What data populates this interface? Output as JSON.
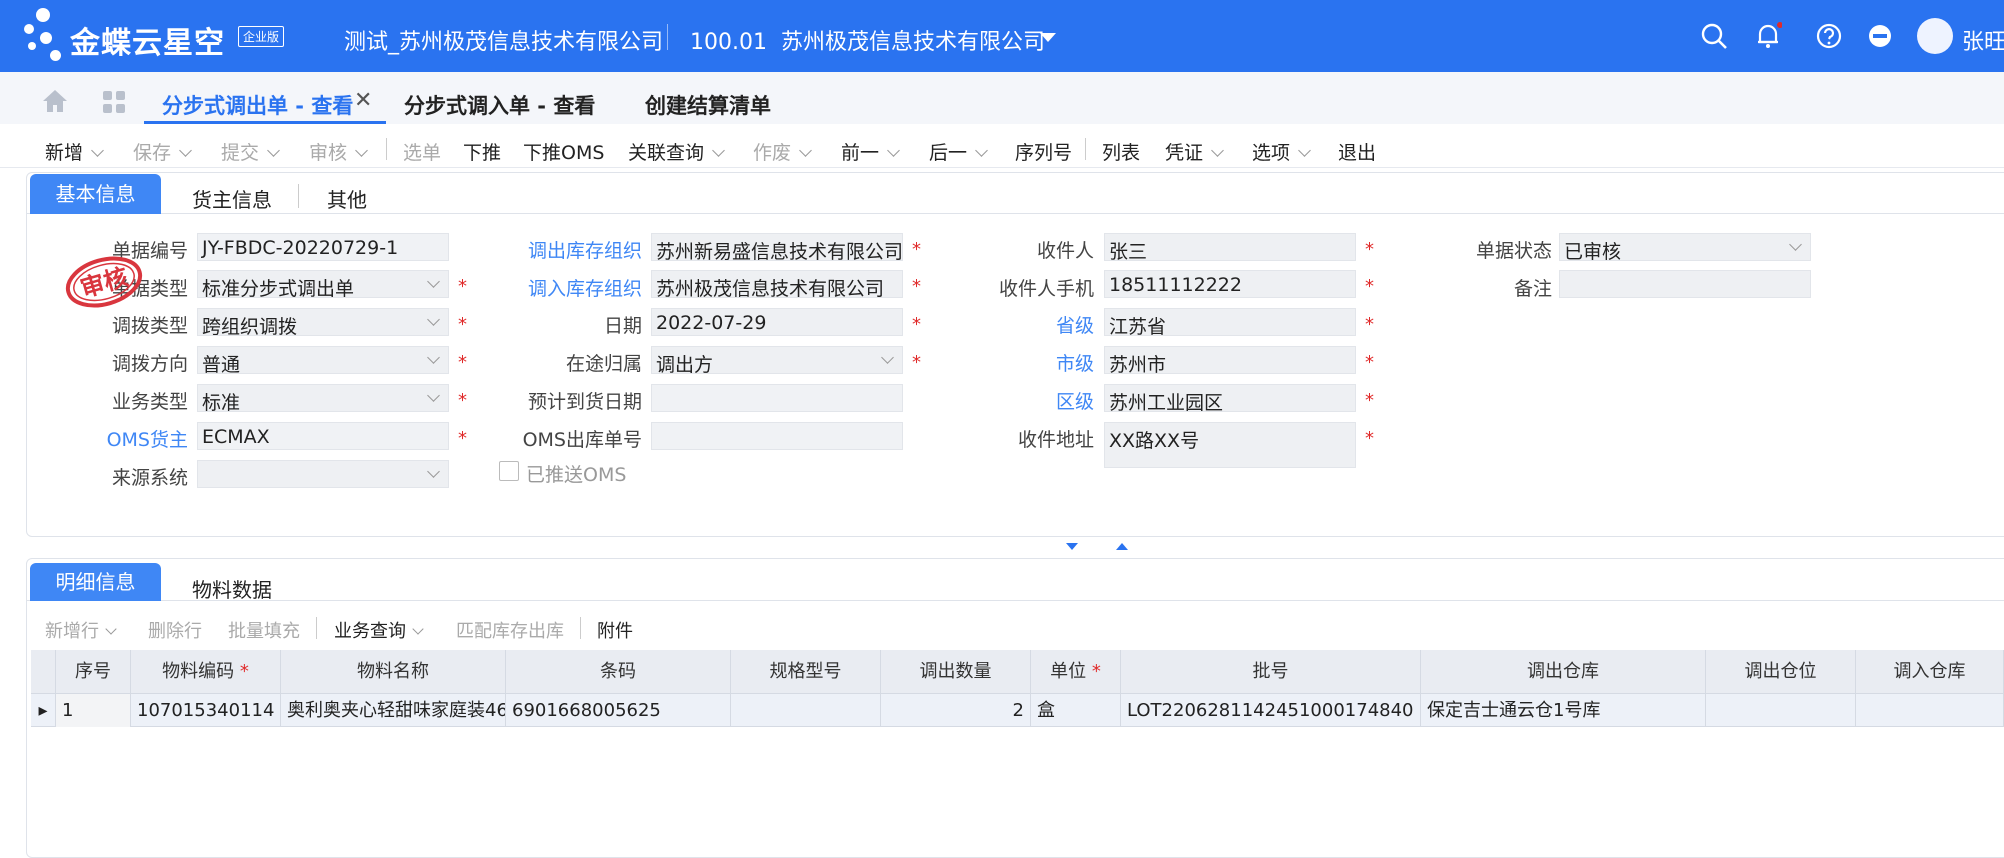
{
  "app": {
    "logo_text": "金蝶云星空",
    "edition_badge": "企业版",
    "org_name": "测试_苏州极茂信息技术有限公司",
    "org_code": "100.01",
    "org_company": "苏州极茂信息技术有限公司",
    "user_name": "张旺"
  },
  "tabs": {
    "active_label": "分步式调出单 - 查看",
    "tab2_label": "分步式调入单 - 查看",
    "tab3_label": "创建结算清单"
  },
  "toolbar": {
    "new": "新增",
    "save": "保存",
    "submit": "提交",
    "audit": "审核",
    "select": "选单",
    "push_down": "下推",
    "push_oms": "下推OMS",
    "related_query": "关联查询",
    "void": "作废",
    "prev": "前一",
    "next": "后一",
    "serial": "序列号",
    "list": "列表",
    "voucher": "凭证",
    "options": "选项",
    "exit": "退出"
  },
  "upper_tabs": {
    "basic": "基本信息",
    "owner": "货主信息",
    "other": "其他"
  },
  "stamp_text": "审核",
  "form": {
    "doc_no_label": "单据编号",
    "doc_no": "JY-FBDC-20220729-1",
    "doc_type_label": "单据类型",
    "doc_type": "标准分步式调出单",
    "transfer_type_label": "调拨类型",
    "transfer_type": "跨组织调拨",
    "transfer_dir_label": "调拨方向",
    "transfer_dir": "普通",
    "biz_type_label": "业务类型",
    "biz_type": "标准",
    "oms_owner_label": "OMS货主",
    "oms_owner": "ECMAX",
    "source_sys_label": "来源系统",
    "source_sys": "",
    "out_org_label": "调出库存组织",
    "out_org": "苏州新易盛信息技术有限公司",
    "in_org_label": "调入库存组织",
    "in_org": "苏州极茂信息技术有限公司",
    "date_label": "日期",
    "date": "2022-07-29",
    "transit_label": "在途归属",
    "transit": "调出方",
    "expected_label": "预计到货日期",
    "expected": "",
    "oms_out_no_label": "OMS出库单号",
    "oms_out_no": "",
    "pushed_oms_label": "已推送OMS",
    "recipient_label": "收件人",
    "recipient": "张三",
    "phone_label": "收件人手机",
    "phone": "18511112222",
    "province_label": "省级",
    "province": "江苏省",
    "city_label": "市级",
    "city": "苏州市",
    "district_label": "区级",
    "district": "苏州工业园区",
    "address_label": "收件地址",
    "address": "XX路XX号",
    "status_label": "单据状态",
    "status": "已审核",
    "remark_label": "备注",
    "remark": ""
  },
  "lower_tabs": {
    "detail": "明细信息",
    "material": "物料数据"
  },
  "entry_toolbar": {
    "add_row": "新增行",
    "delete_row": "删除行",
    "batch_fill": "批量填充",
    "biz_query": "业务查询",
    "match_stock": "匹配库存出库",
    "attachment": "附件"
  },
  "grid": {
    "columns": [
      "序号",
      "物料编码",
      "物料名称",
      "条码",
      "规格型号",
      "调出数量",
      "单位",
      "批号",
      "调出仓库",
      "调出仓位",
      "调入仓库"
    ],
    "rows": [
      {
        "seq": "1",
        "code": "107015340114",
        "name": "奥利奥夹心轻甜味家庭装46",
        "barcode": "6901668005625",
        "spec": "",
        "qty": "2",
        "unit": "盒",
        "lot": "LOT22062811424510001748​40",
        "out_wh": "保定吉士通云仓1号库",
        "out_loc": "",
        "in_wh": ""
      }
    ]
  },
  "colors": {
    "brand": "#2a73f0",
    "tab_active": "#3f87f5",
    "required": "#e02a2a",
    "stamp": "#d9363e"
  }
}
